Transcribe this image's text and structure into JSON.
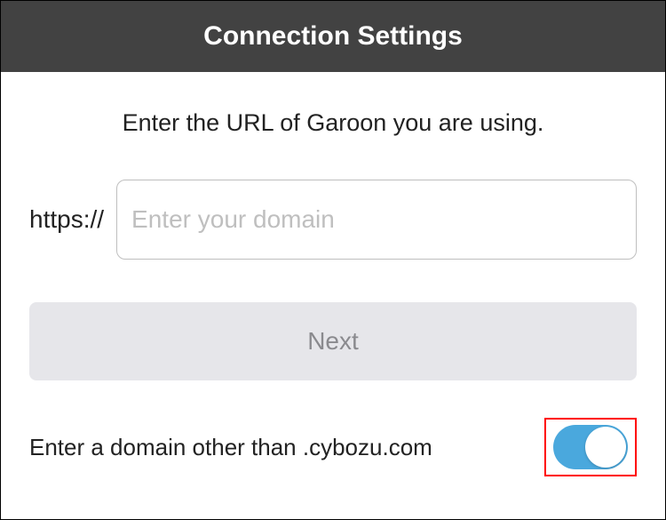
{
  "header": {
    "title": "Connection Settings"
  },
  "instruction": "Enter the URL of Garoon you are using.",
  "form": {
    "protocol": "https://",
    "domain_value": "",
    "domain_placeholder": "Enter your domain",
    "next_label": "Next"
  },
  "toggle": {
    "label": "Enter a domain other than .cybozu.com",
    "state": "on"
  }
}
